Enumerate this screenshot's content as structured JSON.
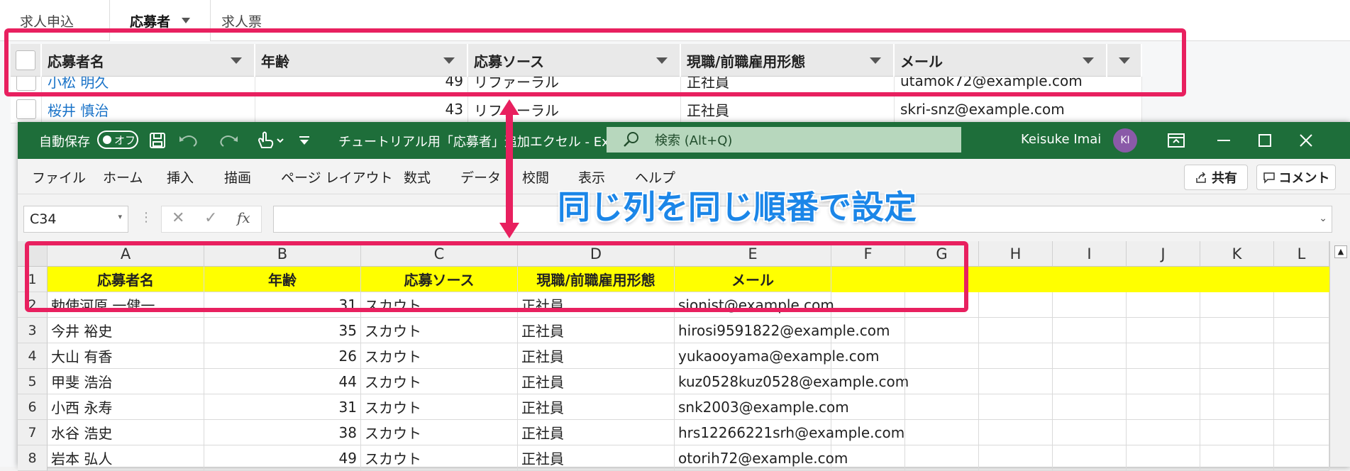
{
  "webapp": {
    "tabs": [
      {
        "label": "求人申込",
        "active": false
      },
      {
        "label": "応募者",
        "active": true
      },
      {
        "label": "求人票",
        "active": false
      }
    ],
    "columns": [
      "応募者名",
      "年齢",
      "応募ソース",
      "現職/前職雇用形態",
      "メール"
    ],
    "rows": [
      {
        "name": "小松 明久",
        "age": "49",
        "source": "リファーラル",
        "type": "正社員",
        "email": "utamok72@example.com"
      },
      {
        "name": "桜井 慎治",
        "age": "43",
        "source": "リファーラル",
        "type": "正社員",
        "email": "skri-snz@example.com"
      }
    ]
  },
  "excel": {
    "title": "チュートリアル用「応募者」追加エクセル  -  Excel",
    "autosave_label": "自動保存",
    "autosave_state": "オフ",
    "search_placeholder": "検索 (Alt+Q)",
    "user_name": "Keisuke Imai",
    "user_initials": "KI",
    "ribbon_tabs": [
      "ファイル",
      "ホーム",
      "挿入",
      "描画",
      "ページ レイアウト",
      "数式",
      "データ",
      "校閲",
      "表示",
      "ヘルプ"
    ],
    "share_label": "共有",
    "comment_label": "コメント",
    "name_box": "C34",
    "fx_label": "fx",
    "columns": [
      "A",
      "B",
      "C",
      "D",
      "E",
      "F",
      "G",
      "H",
      "I",
      "J",
      "K",
      "L"
    ],
    "header_row": {
      "row": "1",
      "cells": [
        "応募者名",
        "年齢",
        "応募ソース",
        "現職/前職雇用形態",
        "メール"
      ]
    },
    "rows": [
      {
        "row": "2",
        "name": "勅使河原 一健一",
        "age": "31",
        "source": "スカウト",
        "type": "正社員",
        "email": "sionist@example.com"
      },
      {
        "row": "3",
        "name": "今井 裕史",
        "age": "35",
        "source": "スカウト",
        "type": "正社員",
        "email": "hirosi9591822@example.com"
      },
      {
        "row": "4",
        "name": "大山 有香",
        "age": "26",
        "source": "スカウト",
        "type": "正社員",
        "email": "yukaooyama@example.com"
      },
      {
        "row": "5",
        "name": "甲斐 浩治",
        "age": "44",
        "source": "スカウト",
        "type": "正社員",
        "email": "kuz0528kuz0528@example.com"
      },
      {
        "row": "6",
        "name": "小西 永寿",
        "age": "31",
        "source": "スカウト",
        "type": "正社員",
        "email": "snk2003@example.com"
      },
      {
        "row": "7",
        "name": "水谷 浩史",
        "age": "38",
        "source": "スカウト",
        "type": "正社員",
        "email": "hrs12266221srh@example.com"
      },
      {
        "row": "8",
        "name": "岩本 弘人",
        "age": "49",
        "source": "スカウト",
        "type": "正社員",
        "email": "otorih72@example.com"
      }
    ]
  },
  "annotation": {
    "caption": "同じ列を同じ順番で設定",
    "color": "#e8205f",
    "caption_color": "#1b86e8"
  },
  "colors": {
    "excel_green": "#1e6e3a",
    "header_highlight": "#ffff00",
    "link_blue": "#1a73c8"
  }
}
